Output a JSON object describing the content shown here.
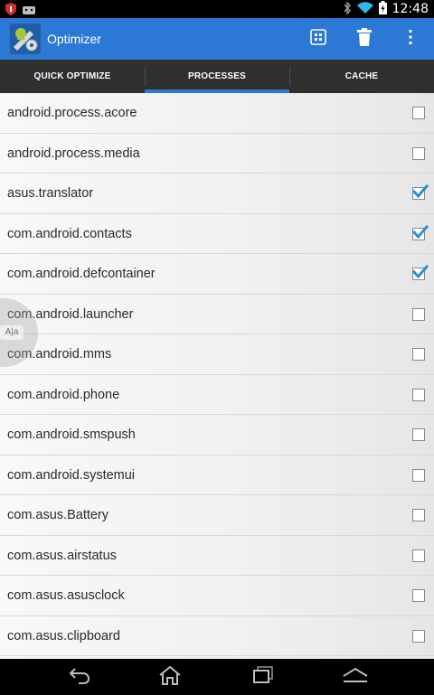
{
  "status_bar": {
    "time": "12:48",
    "icons": [
      "shield-icon",
      "android-notification-icon",
      "bluetooth-icon",
      "wifi-icon",
      "battery-icon"
    ]
  },
  "action_bar": {
    "title": "Optimizer",
    "accent_color": "#2b79d4",
    "actions": [
      {
        "icon": "widget-grid-icon"
      },
      {
        "icon": "trash-icon"
      },
      {
        "icon": "overflow-menu-icon"
      }
    ]
  },
  "tabs": [
    {
      "label": "QUICK OPTIMIZE",
      "active": false
    },
    {
      "label": "PROCESSES",
      "active": true
    },
    {
      "label": "CACHE",
      "active": false
    }
  ],
  "processes": [
    {
      "name": "android.process.acore",
      "checked": false
    },
    {
      "name": "android.process.media",
      "checked": false
    },
    {
      "name": "asus.translator",
      "checked": true
    },
    {
      "name": "com.android.contacts",
      "checked": true
    },
    {
      "name": "com.android.defcontainer",
      "checked": true
    },
    {
      "name": "com.android.launcher",
      "checked": false
    },
    {
      "name": "com.android.mms",
      "checked": false
    },
    {
      "name": "com.android.phone",
      "checked": false
    },
    {
      "name": "com.android.smspush",
      "checked": false
    },
    {
      "name": "com.android.systemui",
      "checked": false
    },
    {
      "name": "com.asus.Battery",
      "checked": false
    },
    {
      "name": "com.asus.airstatus",
      "checked": false
    },
    {
      "name": "com.asus.asusclock",
      "checked": false
    },
    {
      "name": "com.asus.clipboard",
      "checked": false
    }
  ],
  "side_handle": {
    "label": "A|a"
  },
  "nav_bar": {
    "buttons": [
      {
        "icon": "back-icon"
      },
      {
        "icon": "home-icon"
      },
      {
        "icon": "recent-apps-icon"
      },
      {
        "icon": "menu-up-icon"
      }
    ]
  }
}
